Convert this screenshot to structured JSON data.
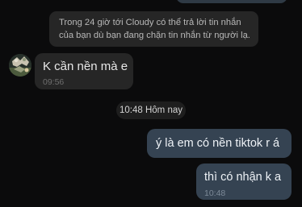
{
  "notice": {
    "line1": "Trong 24 giờ tới Cloudy có thể trả lời tin nhắn",
    "line2": "của bạn dù bạn đang chặn tin nhắn từ người lạ."
  },
  "incoming_message": {
    "text": "K cần nền mà e",
    "time": "09:56"
  },
  "divider": {
    "label": "10:48 Hôm nay"
  },
  "outgoing_messages": [
    {
      "text": "ý là em có nền tiktok r á",
      "time": ""
    },
    {
      "text": "thì có nhận k a",
      "time": "10:48"
    }
  ],
  "colors": {
    "background": "#0b0b0c",
    "incoming_bubble": "#262626",
    "outgoing_bubble": "#354352",
    "timestamp_pill": "#1e1e1e"
  },
  "icons": {
    "sender_avatar": "avatar"
  }
}
